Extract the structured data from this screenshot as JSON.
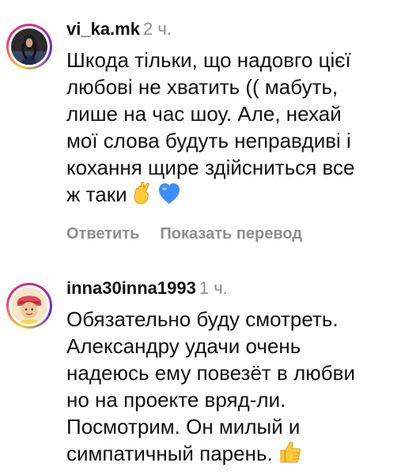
{
  "comments": [
    {
      "username": "vi_ka.mk",
      "time": "2 ч.",
      "text": "Шкода тільки, що надовго цієї\nлюбові не хватить (( мабуть,\nлише на час шоу. Але, нехай\nмої слова будуть неправдиві і\nкохання щире здійсниться все\nж таки",
      "emojis": [
        "crossed-fingers-emoji",
        "blue-heart-emoji"
      ],
      "reply_label": "Ответить",
      "translate_label": "Показать перевод"
    },
    {
      "username": "inna30inna1993",
      "time": "1 ч.",
      "text": "Обязательно буду смотреть.\nАлександру удачи очень\nнадеюсь ему повезёт в любви\nно на проекте вряд-ли.\nПосмотрим. Он милый и\nсимпатичный парень.",
      "emojis": [
        "thumbs-up-emoji"
      ]
    }
  ],
  "colors": {
    "text": "#111111",
    "muted": "#8e8e8e",
    "heart": "#3d8cff",
    "thumb": "#ffcb3d"
  }
}
